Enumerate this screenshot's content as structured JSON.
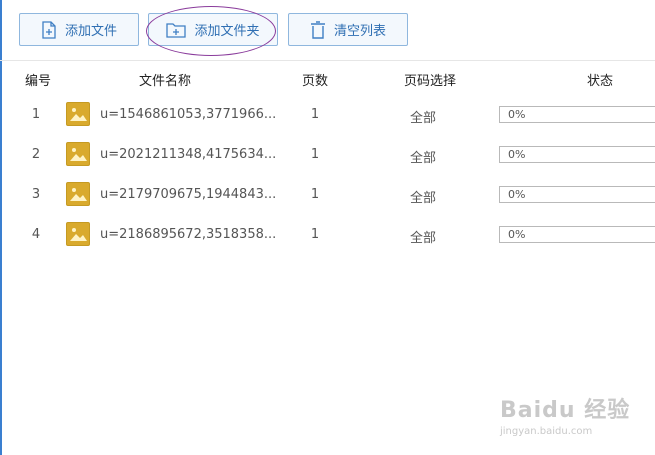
{
  "toolbar": {
    "add_file": "添加文件",
    "add_folder": "添加文件夹",
    "clear_list": "清空列表"
  },
  "table": {
    "headers": {
      "index": "编号",
      "filename": "文件名称",
      "pages": "页数",
      "page_select": "页码选择",
      "status": "状态"
    },
    "rows": [
      {
        "index": "1",
        "name": "u=1546861053,3771966...",
        "pages": "1",
        "page_select": "全部",
        "progress": "0%",
        "progress_value": 0
      },
      {
        "index": "2",
        "name": "u=2021211348,4175634...",
        "pages": "1",
        "page_select": "全部",
        "progress": "0%",
        "progress_value": 0
      },
      {
        "index": "3",
        "name": "u=2179709675,1944843...",
        "pages": "1",
        "page_select": "全部",
        "progress": "0%",
        "progress_value": 0
      },
      {
        "index": "4",
        "name": "u=2186895672,3518358...",
        "pages": "1",
        "page_select": "全部",
        "progress": "0%",
        "progress_value": 0
      }
    ]
  },
  "watermark": {
    "logo": "Baidu 经验",
    "url": "jingyan.baidu.com"
  },
  "colors": {
    "accent": "#2f6fb3",
    "button_border": "#8fb7de",
    "highlight_ellipse": "#8a3c9c",
    "thumbnail": "#d9aa2d"
  }
}
